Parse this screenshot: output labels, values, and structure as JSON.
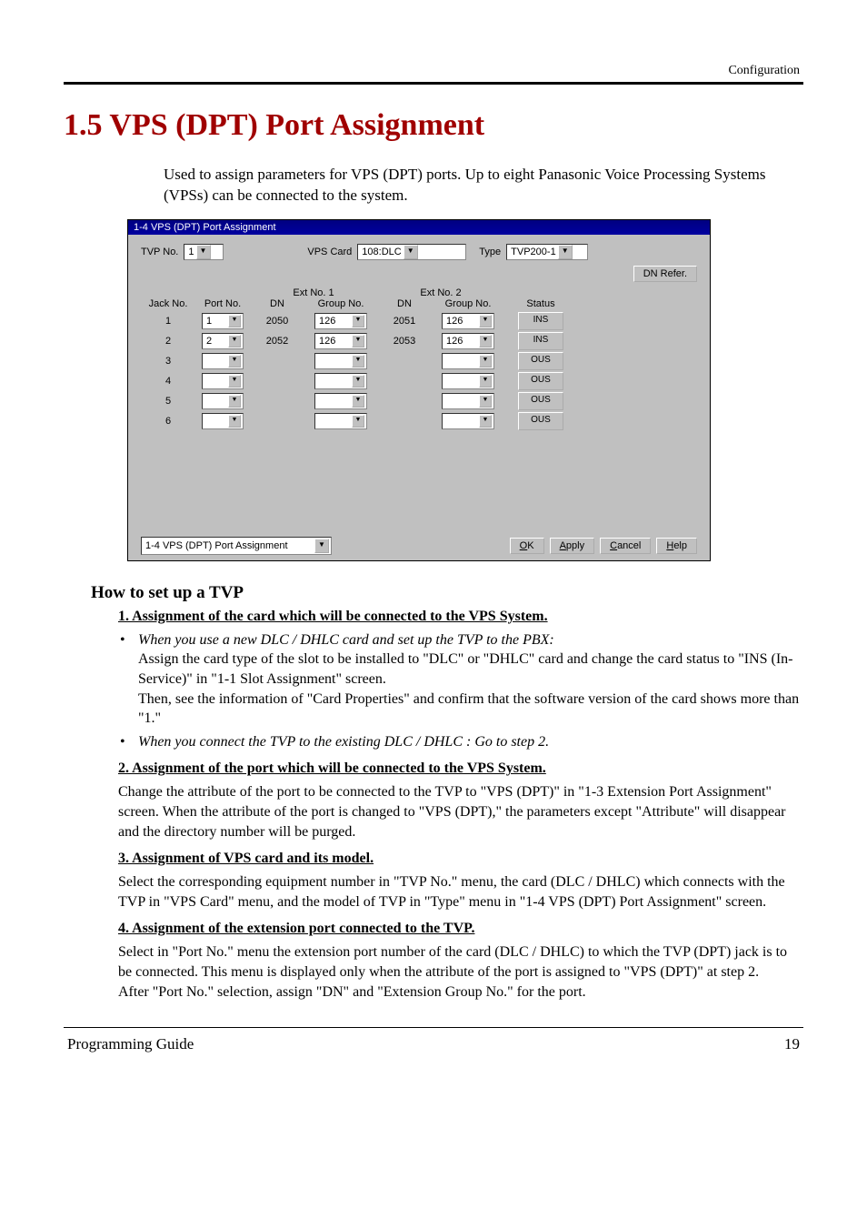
{
  "header_right": "Configuration",
  "title": "1.5   VPS (DPT) Port Assignment",
  "intro": "Used to assign parameters for VPS (DPT) ports. Up to eight Panasonic Voice Processing Systems (VPSs) can be connected to the system.",
  "dlg": {
    "title": "1-4 VPS (DPT) Port Assignment",
    "tvp_no_label": "TVP No.",
    "tvp_no_value": "1",
    "vps_card_label": "VPS Card",
    "vps_card_value": "108:DLC",
    "type_label": "Type",
    "type_value": "TVP200-1",
    "dn_refer_btn": "DN Refer.",
    "col": {
      "jack": "Jack No.",
      "port": "Port No.",
      "ext1": "Ext No. 1",
      "ext2": "Ext No. 2",
      "dn": "DN",
      "group": "Group No.",
      "status": "Status"
    },
    "rows": [
      {
        "jack": "1",
        "port": "1",
        "dn1": "2050",
        "grp1": "126",
        "dn2": "2051",
        "grp2": "126",
        "status": "INS"
      },
      {
        "jack": "2",
        "port": "2",
        "dn1": "2052",
        "grp1": "126",
        "dn2": "2053",
        "grp2": "126",
        "status": "INS"
      },
      {
        "jack": "3",
        "port": "",
        "dn1": "",
        "grp1": "",
        "dn2": "",
        "grp2": "",
        "status": "OUS"
      },
      {
        "jack": "4",
        "port": "",
        "dn1": "",
        "grp1": "",
        "dn2": "",
        "grp2": "",
        "status": "OUS"
      },
      {
        "jack": "5",
        "port": "",
        "dn1": "",
        "grp1": "",
        "dn2": "",
        "grp2": "",
        "status": "OUS"
      },
      {
        "jack": "6",
        "port": "",
        "dn1": "",
        "grp1": "",
        "dn2": "",
        "grp2": "",
        "status": "OUS"
      }
    ],
    "bottom_combo": "1-4 VPS (DPT) Port Assignment",
    "ok": "OK",
    "apply": "Apply",
    "cancel": "Cancel",
    "help": "Help"
  },
  "how_title": "How to set up a TVP",
  "step1": {
    "heading": "1. Assignment of the card which will be connected to the VPS System.",
    "bullet1_it": "When you use a new DLC / DHLC card and set up the TVP to the PBX:",
    "bullet1_txt": "Assign the card type of the slot to be installed to \"DLC\" or \"DHLC\" card and change the card status to \"INS (In-Service)\" in \"1-1 Slot Assignment\" screen.\nThen, see the information of \"Card Properties\" and confirm that the software version of the card shows more than \"1.\"",
    "bullet2_it": "When you connect the TVP to the existing DLC / DHLC : Go to step 2."
  },
  "step2": {
    "heading": "2. Assignment of the port which will be connected to the VPS System.",
    "txt": "Change the attribute of the port to be connected to the TVP to \"VPS (DPT)\" in \"1-3 Extension Port Assignment\" screen. When the attribute of the port is changed to \"VPS (DPT),\" the parameters except \"Attribute\" will disappear and the directory number will be purged."
  },
  "step3": {
    "heading": "3. Assignment of VPS card and its model.",
    "txt": "Select the corresponding equipment number in \"TVP No.\" menu, the card (DLC / DHLC) which connects with the TVP in \"VPS Card\" menu, and the model of TVP in \"Type\" menu in \"1-4 VPS (DPT) Port Assignment\" screen."
  },
  "step4": {
    "heading": "4. Assignment of the extension port connected to the TVP.",
    "txt": "Select in \"Port No.\" menu the extension port number of the card (DLC / DHLC) to which the TVP (DPT) jack is to be connected. This menu is displayed only when the attribute of the port is assigned to \"VPS (DPT)\" at step 2.\nAfter \"Port No.\" selection, assign \"DN\" and \"Extension Group No.\" for the port."
  },
  "footer_left": "Programming Guide",
  "footer_right": "19"
}
